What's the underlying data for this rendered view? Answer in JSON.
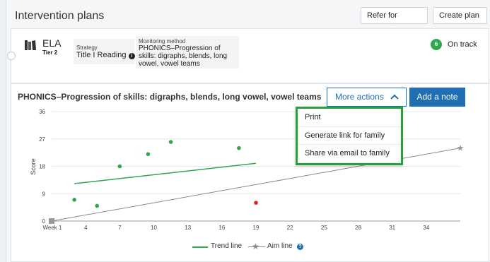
{
  "header": {
    "title": "Intervention plans",
    "refer_button": "Refer for support",
    "create_button": "Create plan"
  },
  "plan": {
    "subject": "ELA",
    "tier": "Tier 2",
    "strategy_label": "Strategy",
    "strategy_value": "Title I Reading",
    "method_label": "Monitoring method",
    "method_value": "PHONICS–Progression of skills: digraphs, blends, long vowel, vowel teams",
    "status_count": "6",
    "status_text": "On track",
    "status_color": "#2fa84f"
  },
  "chart_panel": {
    "title": "PHONICS–Progression of skills: digraphs, blends, long vowel, vowel teams",
    "more_actions": "More actions",
    "add_note": "Add a note",
    "menu": [
      "Print",
      "Generate link for family",
      "Share via email to family"
    ],
    "legend_trend": "Trend line",
    "legend_aim": "Aim line",
    "accent": "#1f6fb2",
    "menu_highlight": "#24a33a"
  },
  "chart_data": {
    "type": "scatter",
    "ylabel": "Score",
    "xlabel": "",
    "x_tick_labels": [
      "Week 1",
      "4",
      "7",
      "10",
      "13",
      "16",
      "19",
      "22",
      "25",
      "28",
      "31",
      "34"
    ],
    "x_ticks": [
      1,
      4,
      7,
      10,
      13,
      16,
      19,
      22,
      25,
      28,
      31,
      34
    ],
    "y_ticks": [
      0,
      9,
      18,
      27,
      36
    ],
    "xlim": [
      1,
      37
    ],
    "ylim": [
      0,
      36
    ],
    "grid": true,
    "legend": "bottom-center",
    "points": [
      {
        "x": 3,
        "y": 7,
        "color": "#2fa84f"
      },
      {
        "x": 5,
        "y": 5,
        "color": "#2fa84f"
      },
      {
        "x": 7,
        "y": 18,
        "color": "#2fa84f"
      },
      {
        "x": 9.5,
        "y": 22,
        "color": "#2fa84f"
      },
      {
        "x": 11.5,
        "y": 26,
        "color": "#2fa84f"
      },
      {
        "x": 17.5,
        "y": 24,
        "color": "#2fa84f"
      },
      {
        "x": 19,
        "y": 6,
        "color": "#d62828"
      }
    ],
    "series": [
      {
        "name": "Trend line",
        "color": "#2fa84f",
        "x": [
          3,
          19
        ],
        "y": [
          12.3,
          19
        ]
      },
      {
        "name": "Aim line",
        "color": "#888888",
        "x": [
          1,
          37
        ],
        "y": [
          0,
          24
        ]
      }
    ]
  }
}
